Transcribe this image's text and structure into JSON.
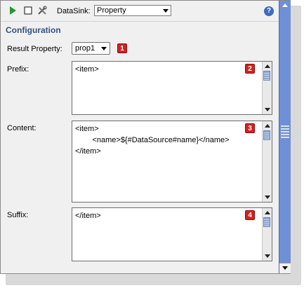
{
  "toolbar": {
    "icons": [
      "play-icon",
      "stop-icon",
      "tools-icon",
      "help-icon"
    ],
    "datasink_label": "DataSink:",
    "datasink_value": "Property",
    "help_glyph": "?"
  },
  "section": {
    "title": "Configuration"
  },
  "result_property": {
    "label": "Result Property:",
    "value": "prop1",
    "badge": "1"
  },
  "prefix": {
    "label": "Prefix:",
    "text": "<item>",
    "badge": "2"
  },
  "content": {
    "label": "Content:",
    "text": "<item>\n        <name>${#DataSource#name}</name>\n</item>",
    "badge": "3"
  },
  "suffix": {
    "label": "Suffix:",
    "text": "</item>",
    "badge": "4"
  },
  "colors": {
    "accent": "#33527f",
    "badge": "#d62020",
    "scrollbar": "#6f8fd6",
    "play": "#1f9a2e"
  }
}
